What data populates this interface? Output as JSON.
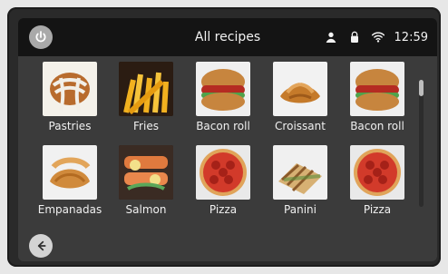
{
  "header": {
    "title": "All recipes",
    "time": "12:59"
  },
  "icons": {
    "power": "power-icon",
    "user": "user-icon",
    "lock": "lock-icon",
    "wifi": "wifi-icon",
    "back": "back-arrow-icon"
  },
  "recipes": [
    {
      "label": "Pastries"
    },
    {
      "label": "Fries"
    },
    {
      "label": "Bacon roll"
    },
    {
      "label": "Croissant"
    },
    {
      "label": "Bacon roll"
    },
    {
      "label": "Empanadas"
    },
    {
      "label": "Salmon"
    },
    {
      "label": "Pizza"
    },
    {
      "label": "Panini"
    },
    {
      "label": "Pizza"
    }
  ]
}
